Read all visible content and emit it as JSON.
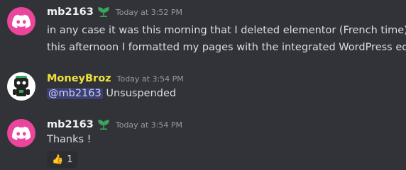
{
  "messages": [
    {
      "username": "mb2163",
      "timestamp": "Today at 3:52 PM",
      "lines": [
        "in any case it was this morning that I deleted elementor (French time)",
        "this afternoon I formatted my pages with the integrated WordPress editor"
      ]
    },
    {
      "username": "MoneyBroz",
      "timestamp": "Today at 3:54 PM",
      "mention": "@mb2163",
      "text": " Unsuspended"
    },
    {
      "username": "mb2163",
      "timestamp": "Today at 3:54 PM",
      "text": "Thanks !",
      "reaction": {
        "emoji": "👍",
        "count": "1"
      }
    }
  ],
  "colors": {
    "background": "#313338",
    "discord_avatar": "#eb459e",
    "badge_green": "#3ba55c",
    "bot_name": "#f0e13a",
    "mention_bg": "rgba(88,101,242,0.3)"
  },
  "icons": {
    "avatar_user": "discord-logo-icon",
    "avatar_bot": "robot-avatar-icon",
    "badge": "leaf-badge-icon",
    "reaction": "thumbs-up-icon"
  }
}
